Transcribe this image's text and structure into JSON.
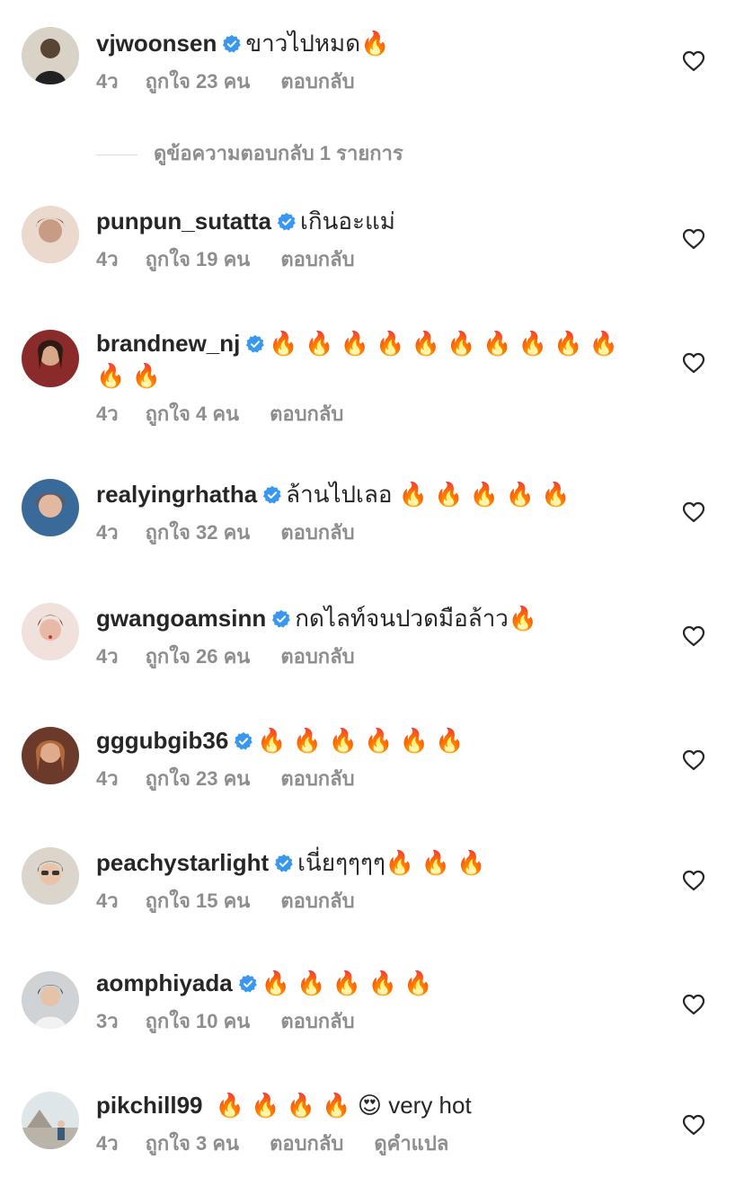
{
  "colors": {
    "text": "#262626",
    "meta": "#8e8e8e",
    "verified": "#3897f0",
    "divider": "#dbdbdb"
  },
  "view_replies_label": "ดูข้อความตอบกลับ 1 รายการ",
  "comments": [
    {
      "username": "vjwoonsen",
      "verified": true,
      "text": "ขาวไปหมด🔥",
      "time": "4ว",
      "likes": "ถูกใจ 23 คน",
      "reply": "ตอบกลับ",
      "avatar_icon": "user-avatar"
    },
    {
      "username": "punpun_sutatta",
      "verified": true,
      "text": "เกินอะแม่",
      "time": "4ว",
      "likes": "ถูกใจ 19 คน",
      "reply": "ตอบกลับ",
      "avatar_icon": "user-avatar"
    },
    {
      "username": "brandnew_nj",
      "verified": true,
      "text": "🔥 🔥 🔥 🔥 🔥 🔥 🔥 🔥 🔥 🔥 🔥 🔥",
      "time": "4ว",
      "likes": "ถูกใจ 4 คน",
      "reply": "ตอบกลับ",
      "avatar_icon": "user-avatar"
    },
    {
      "username": "realyingrhatha",
      "verified": true,
      "text": "ล้านไปเลอ 🔥 🔥 🔥 🔥 🔥",
      "time": "4ว",
      "likes": "ถูกใจ 32 คน",
      "reply": "ตอบกลับ",
      "avatar_icon": "user-avatar"
    },
    {
      "username": "gwangoamsinn",
      "verified": true,
      "text": "กดไลท์จนปวดมือล้าว🔥",
      "time": "4ว",
      "likes": "ถูกใจ 26 คน",
      "reply": "ตอบกลับ",
      "avatar_icon": "user-avatar"
    },
    {
      "username": "gggubgib36",
      "verified": true,
      "text": "🔥 🔥 🔥 🔥 🔥 🔥",
      "time": "4ว",
      "likes": "ถูกใจ 23 คน",
      "reply": "ตอบกลับ",
      "avatar_icon": "user-avatar"
    },
    {
      "username": "peachystarlight",
      "verified": true,
      "text": "เนี่ยๆๆๆๆ🔥 🔥 🔥",
      "time": "4ว",
      "likes": "ถูกใจ 15 คน",
      "reply": "ตอบกลับ",
      "avatar_icon": "user-avatar"
    },
    {
      "username": "aomphiyada",
      "verified": true,
      "text": "🔥 🔥 🔥 🔥 🔥",
      "time": "3ว",
      "likes": "ถูกใจ 10 คน",
      "reply": "ตอบกลับ",
      "avatar_icon": "user-avatar"
    },
    {
      "username": "pikchill99",
      "verified": false,
      "text": "🔥 🔥 🔥 🔥 😍 very hot",
      "time": "4ว",
      "likes": "ถูกใจ 3 คน",
      "reply": "ตอบกลับ",
      "translate": "ดูคำแปล",
      "avatar_icon": "user-avatar"
    }
  ]
}
